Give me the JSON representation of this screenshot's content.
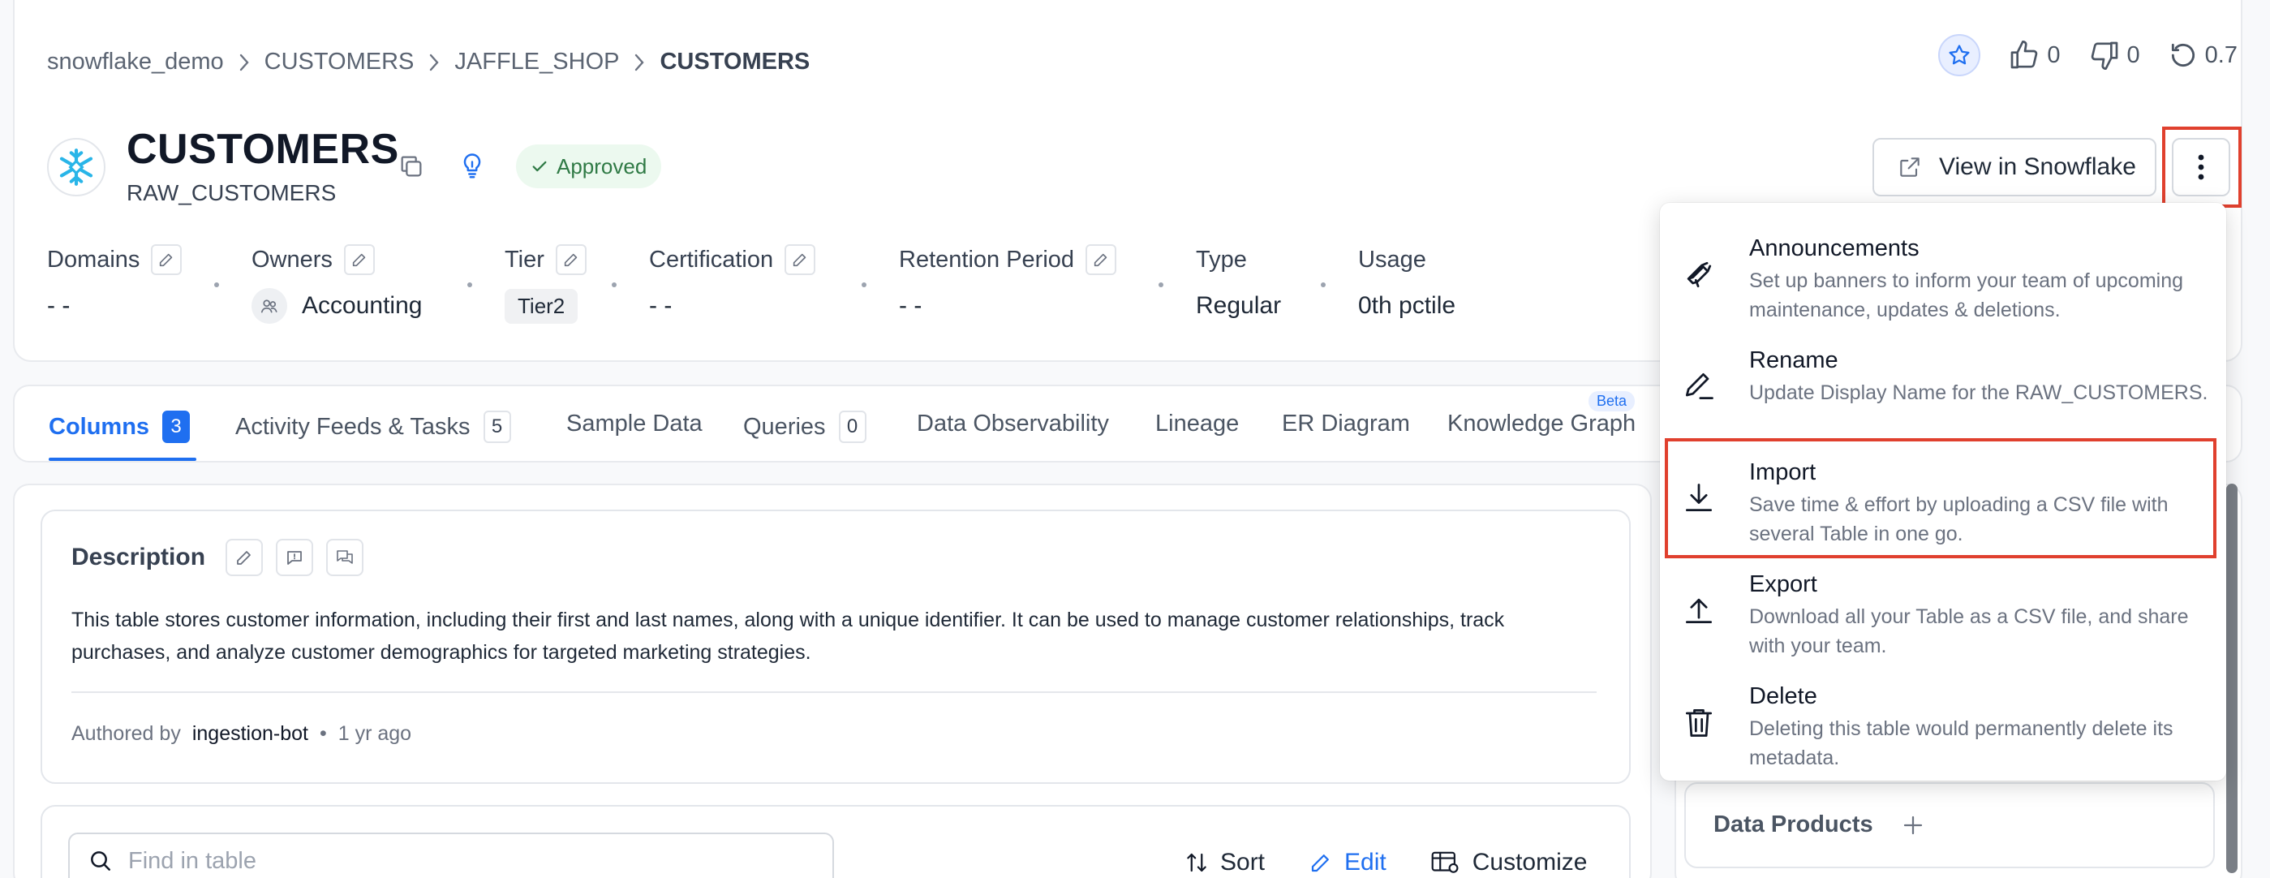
{
  "breadcrumb": [
    "snowflake_demo",
    "CUSTOMERS",
    "JAFFLE_SHOP",
    "CUSTOMERS"
  ],
  "top_actions": {
    "likes": "0",
    "dislikes": "0",
    "version": "0.7"
  },
  "entity": {
    "title": "CUSTOMERS",
    "subtitle": "RAW_CUSTOMERS",
    "status": "Approved",
    "view_button": "View in Snowflake"
  },
  "properties": [
    {
      "label": "Domains",
      "value": "- -"
    },
    {
      "label": "Owners",
      "value": "Accounting"
    },
    {
      "label": "Tier",
      "value": "Tier2"
    },
    {
      "label": "Certification",
      "value": "- -"
    },
    {
      "label": "Retention Period",
      "value": "- -"
    },
    {
      "label": "Type",
      "value": "Regular"
    },
    {
      "label": "Usage",
      "value": "0th pctile"
    }
  ],
  "tabs": [
    {
      "label": "Columns",
      "count": "3"
    },
    {
      "label": "Activity Feeds & Tasks",
      "count": "5"
    },
    {
      "label": "Sample Data"
    },
    {
      "label": "Queries",
      "count": "0"
    },
    {
      "label": "Data Observability"
    },
    {
      "label": "Lineage"
    },
    {
      "label": "ER Diagram"
    },
    {
      "label": "Knowledge Graph",
      "badge": "Beta"
    }
  ],
  "description": {
    "title": "Description",
    "text": "This table stores customer information, including their first and last names, along with a unique identifier. It can be used to manage customer relationships, track purchases, and analyze customer demographics for targeted marketing strategies.",
    "authored_prefix": "Authored by",
    "author": "ingestion-bot",
    "time": "1 yr ago"
  },
  "table_toolbar": {
    "search_placeholder": "Find in table",
    "sort": "Sort",
    "edit": "Edit",
    "customize": "Customize"
  },
  "right_panel": {
    "data_products": "Data Products"
  },
  "menu": [
    {
      "title": "Announcements",
      "desc": "Set up banners to inform your team of upcoming maintenance, updates & deletions.",
      "icon": "megaphone-icon"
    },
    {
      "title": "Rename",
      "desc": "Update Display Name for the RAW_CUSTOMERS.",
      "icon": "pencil-icon"
    },
    {
      "title": "Import",
      "desc": "Save time & effort by uploading a CSV file with several Table in one go.",
      "icon": "download-icon"
    },
    {
      "title": "Export",
      "desc": "Download all your Table as a CSV file, and share with your team.",
      "icon": "upload-icon"
    },
    {
      "title": "Delete",
      "desc": "Deleting this table would permanently delete its metadata.",
      "icon": "trash-icon"
    }
  ],
  "colors": {
    "accent": "#1f6ff0",
    "highlight": "#e0402e",
    "approved_bg": "#ecf9ef",
    "approved_text": "#2f7a45"
  }
}
